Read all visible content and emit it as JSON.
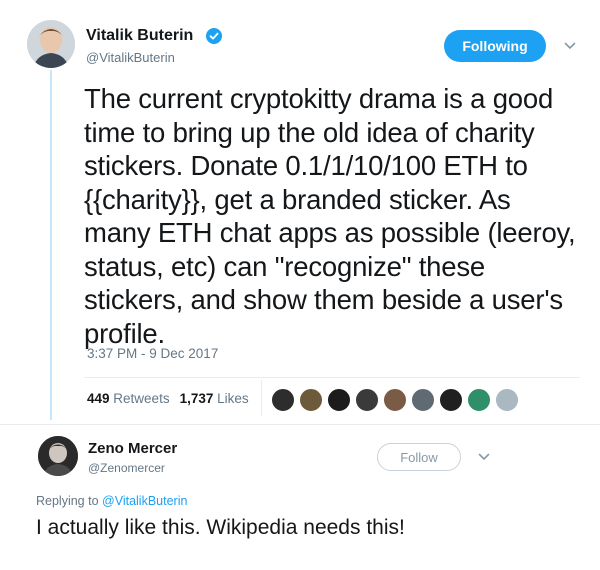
{
  "tweet": {
    "author_name": "Vitalik Buterin",
    "author_handle": "@VitalikButerin",
    "verified": true,
    "follow_label": "Following",
    "text": "The current cryptokitty drama is a good\ntime to bring up the old idea of charity\nstickers. Donate 0.1/1/10/100 ETH to\n{{charity}}, get a branded sticker. As\nmany ETH chat apps as possible (leeroy,\nstatus, etc) can \"recognize\" these\nstickers, and show them beside a user's\nprofile.",
    "timestamp": "3:37 PM - 9 Dec 2017",
    "retweet_count": "449",
    "retweet_label": "Retweets",
    "like_count": "1,737",
    "like_label": "Likes",
    "liker_avatar_count": 9
  },
  "reply": {
    "author_name": "Zeno Mercer",
    "author_handle": "@Zenomercer",
    "follow_label": "Follow",
    "replying_to_prefix": "Replying to",
    "replying_to_handle": "@VitalikButerin",
    "text": "I actually like this. Wikipedia needs this!"
  },
  "colors": {
    "accent": "#1da1f2",
    "text": "#14171a",
    "muted": "#657786",
    "thread_line": "#c4e7fb",
    "divider": "#e6ecf0"
  },
  "icons": [
    "verified-badge-icon",
    "chevron-down-icon",
    "chevron-down-icon"
  ]
}
